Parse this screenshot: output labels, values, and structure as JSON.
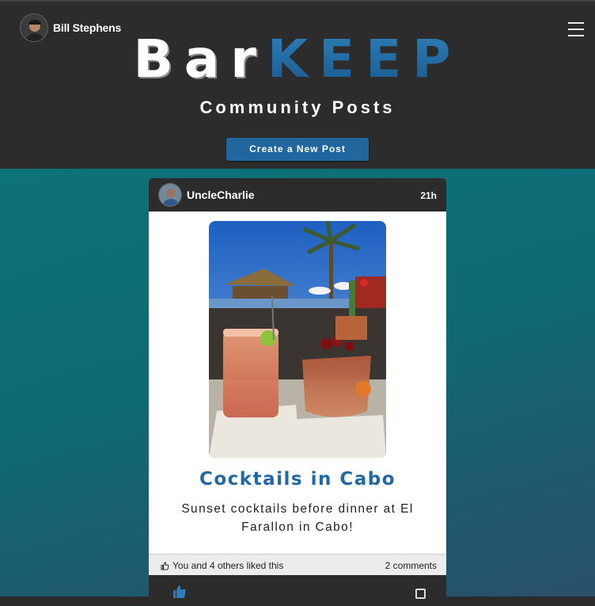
{
  "header": {
    "user_name": "Bill Stephens",
    "logo_part1": "Bar",
    "logo_part2": "KEEP",
    "subtitle": "Community Posts",
    "create_button": "Create a New Post"
  },
  "post": {
    "author": "UncleCharlie",
    "time": "21h",
    "title": "Cocktails in Cabo",
    "body": "Sunset cocktails before dinner at El Farallon in Cabo!",
    "likes_text": "You and 4 others liked this",
    "comments_text": "2 comments"
  },
  "colors": {
    "header_bg": "#2c2c2d",
    "accent_blue": "#21679d",
    "feed_teal": "#0e7279"
  },
  "icons": [
    "hamburger-menu-icon",
    "thumbs-up-icon",
    "comment-icon"
  ]
}
